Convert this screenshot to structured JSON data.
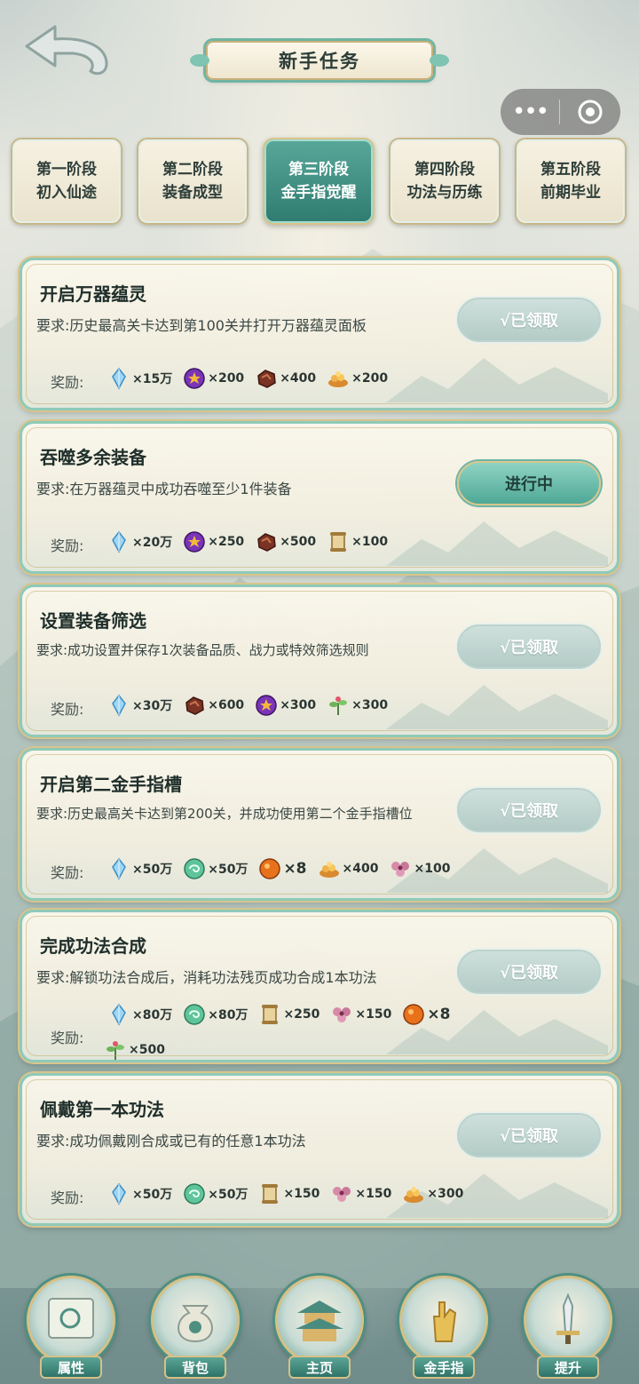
{
  "header": {
    "title": "新手任务",
    "back_icon": "back-arrow-icon",
    "capsule": {
      "more": "•••",
      "close_icon": "target-icon"
    }
  },
  "tabs": [
    {
      "line1": "第一阶段",
      "line2": "初入仙途",
      "active": false
    },
    {
      "line1": "第二阶段",
      "line2": "装备成型",
      "active": false
    },
    {
      "line1": "第三阶段",
      "line2": "金手指觉醒",
      "active": true
    },
    {
      "line1": "第四阶段",
      "line2": "功法与历练",
      "active": false
    },
    {
      "line1": "第五阶段",
      "line2": "前期毕业",
      "active": false
    }
  ],
  "reward_label": "奖励:",
  "tasks": [
    {
      "title": "开启万器蕴灵",
      "requirement": "要求:历史最高关卡达到第100关并打开万器蕴灵面板",
      "button": "√已领取",
      "status": "done",
      "rewards": [
        {
          "icon": "crystal-icon",
          "qty": "×15万"
        },
        {
          "icon": "purple-orb-icon",
          "qty": "×200"
        },
        {
          "icon": "ore-icon",
          "qty": "×400"
        },
        {
          "icon": "gold-pile-icon",
          "qty": "×200"
        }
      ]
    },
    {
      "title": "吞噬多余装备",
      "requirement": "要求:在万器蕴灵中成功吞噬至少1件装备",
      "button": "进行中",
      "status": "in_progress",
      "rewards": [
        {
          "icon": "crystal-icon",
          "qty": "×20万"
        },
        {
          "icon": "purple-orb-icon",
          "qty": "×250"
        },
        {
          "icon": "ore-icon",
          "qty": "×500"
        },
        {
          "icon": "scroll-icon",
          "qty": "×100"
        }
      ]
    },
    {
      "title": "设置装备筛选",
      "requirement": "要求:成功设置并保存1次装备品质、战力或特效筛选规则",
      "button": "√已领取",
      "status": "done",
      "rewards": [
        {
          "icon": "crystal-icon",
          "qty": "×30万"
        },
        {
          "icon": "ore-icon",
          "qty": "×600"
        },
        {
          "icon": "purple-orb-icon",
          "qty": "×300"
        },
        {
          "icon": "herb-icon",
          "qty": "×300"
        }
      ]
    },
    {
      "title": "开启第二金手指槽",
      "requirement": "要求:历史最高关卡达到第200关，并成功使用第二个金手指槽位",
      "button": "√已领取",
      "status": "done",
      "rewards": [
        {
          "icon": "crystal-icon",
          "qty": "×50万"
        },
        {
          "icon": "jade-orb-icon",
          "qty": "×50万"
        },
        {
          "icon": "fire-orb-icon",
          "qty": "×8"
        },
        {
          "icon": "gold-pile-icon",
          "qty": "×400"
        },
        {
          "icon": "pink-flower-icon",
          "qty": "×100"
        }
      ]
    },
    {
      "title": "完成功法合成",
      "requirement": "要求:解锁功法合成后，消耗功法残页成功合成1本功法",
      "button": "√已领取",
      "status": "done",
      "rewards": [
        {
          "icon": "crystal-icon",
          "qty": "×80万"
        },
        {
          "icon": "jade-orb-icon",
          "qty": "×80万"
        },
        {
          "icon": "scroll-icon",
          "qty": "×250"
        },
        {
          "icon": "pink-flower-icon",
          "qty": "×150"
        },
        {
          "icon": "fire-orb-icon",
          "qty": "×8"
        },
        {
          "icon": "herb-icon",
          "qty": "×500"
        }
      ]
    },
    {
      "title": "佩戴第一本功法",
      "requirement": "要求:成功佩戴刚合成或已有的任意1本功法",
      "button": "√已领取",
      "status": "done",
      "rewards": [
        {
          "icon": "crystal-icon",
          "qty": "×50万"
        },
        {
          "icon": "jade-orb-icon",
          "qty": "×50万"
        },
        {
          "icon": "scroll-icon",
          "qty": "×150"
        },
        {
          "icon": "pink-flower-icon",
          "qty": "×150"
        },
        {
          "icon": "gold-pile-icon",
          "qty": "×300"
        }
      ]
    }
  ],
  "bottom_nav": [
    {
      "label": "属性",
      "icon": "scroll-map-icon"
    },
    {
      "label": "背包",
      "icon": "bag-icon"
    },
    {
      "label": "主页",
      "icon": "pagoda-icon"
    },
    {
      "label": "金手指",
      "icon": "golden-hand-icon"
    },
    {
      "label": "提升",
      "icon": "sword-upgrade-icon"
    }
  ],
  "colors": {
    "accent_teal": "#2f7b70",
    "gold_border": "#d6c086",
    "card_bg": "#f6f2e4",
    "done_button": "#b3cbc6"
  }
}
